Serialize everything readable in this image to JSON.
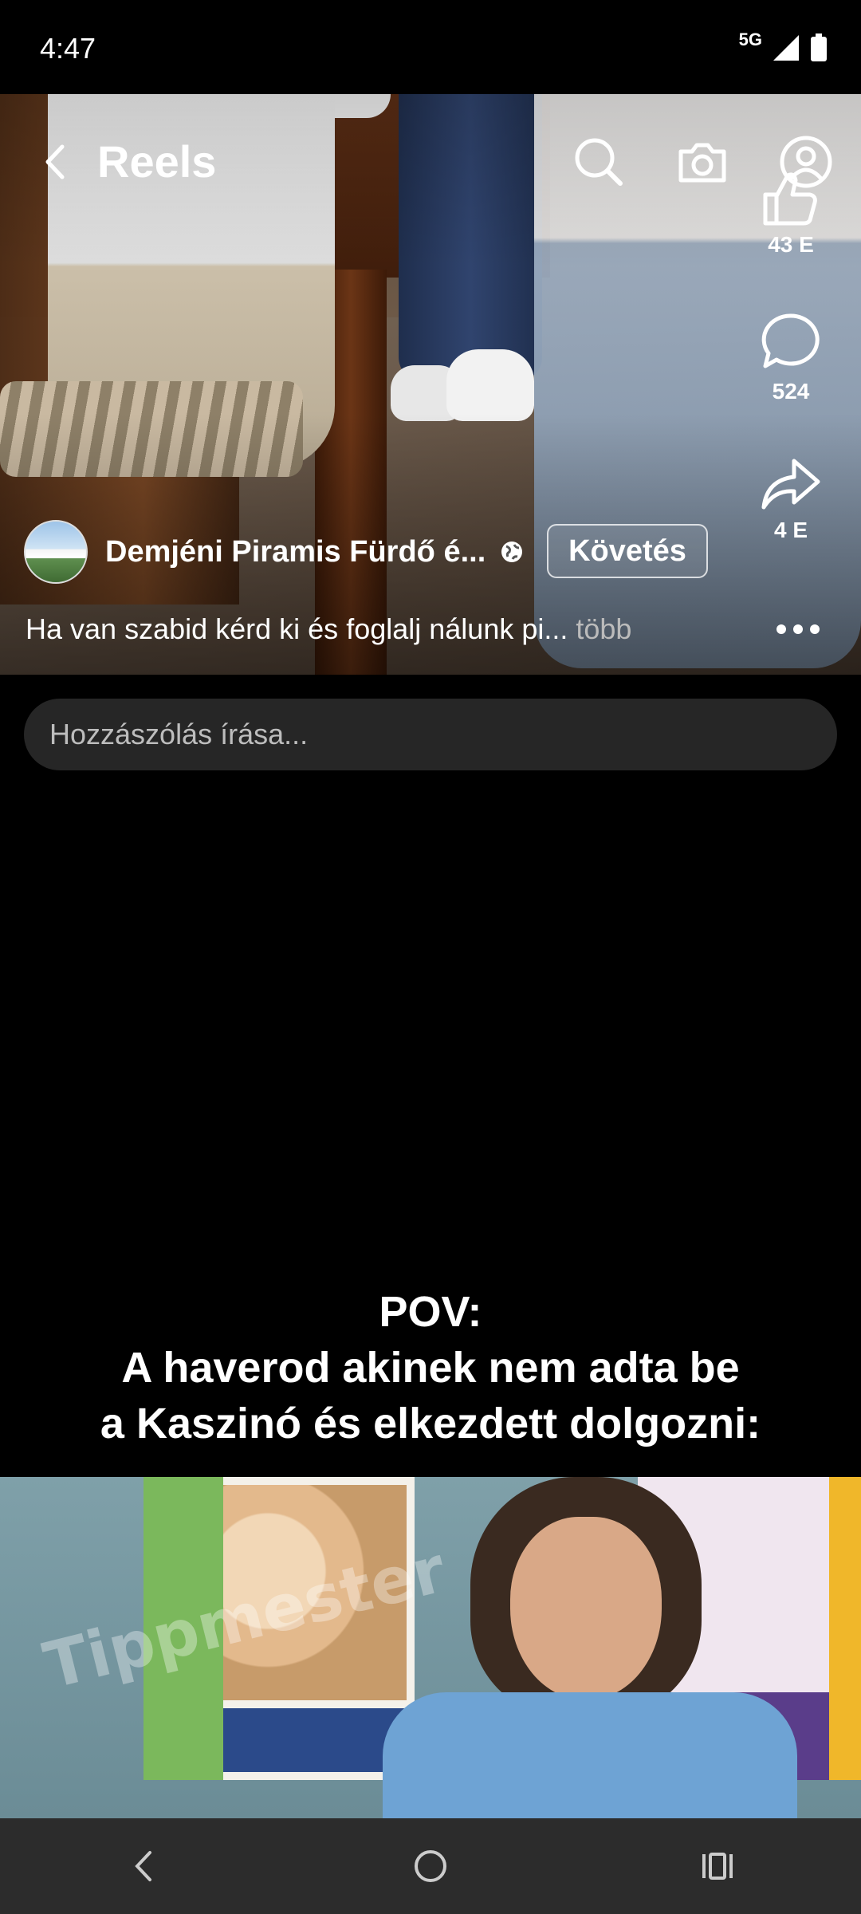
{
  "status_bar": {
    "time": "4:47",
    "network": "5G"
  },
  "header": {
    "title": "Reels"
  },
  "actions": {
    "likes": "43 E",
    "comments": "524",
    "shares": "4 E"
  },
  "post": {
    "author": "Demjéni Piramis Fürdő é...",
    "follow_label": "Követés",
    "caption": "Ha van szabid kérd ki és foglalj nálunk pi...",
    "more_label": "több"
  },
  "comment_box": {
    "placeholder": "Hozzászólás írása..."
  },
  "next_reel": {
    "overlay_line1": "POV:",
    "overlay_line2": "A haverod akinek nem adta be",
    "overlay_line3": "a Kaszinó és elkezdett dolgozni:",
    "watermark": "Tippmester"
  },
  "icons": {
    "back": "chevron-left-icon",
    "search": "search-icon",
    "camera": "camera-icon",
    "profile": "profile-icon",
    "like": "thumbs-up-icon",
    "comment": "comment-bubble-icon",
    "share": "share-arrow-icon",
    "globe": "globe-icon",
    "more": "more-dots-icon"
  }
}
